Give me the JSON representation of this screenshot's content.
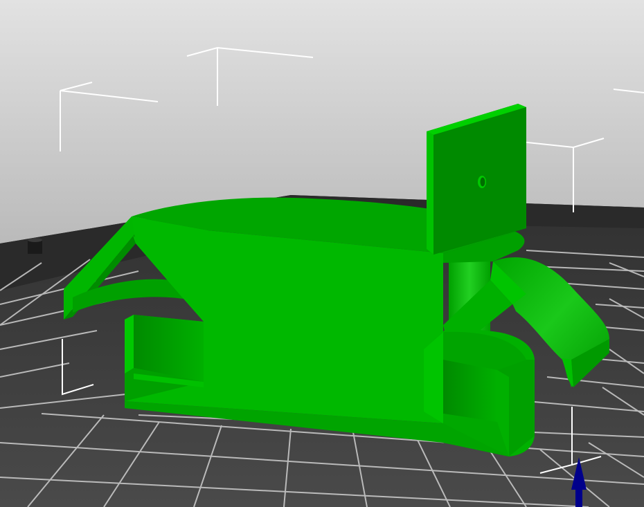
{
  "viewport": {
    "background_top": "#e0e0e0",
    "background_bottom": "#8e8e8e",
    "bed_color": "#3a3a3a",
    "grid_color": "#c8c8c8",
    "border_color": "#222222"
  },
  "model": {
    "color": "#00b800",
    "shade_dark": "#009400",
    "shade_darker": "#007a00",
    "shade_light": "#22d022",
    "selected": true
  },
  "bounding_box": {
    "color": "#ffffff"
  },
  "axis_arrow": {
    "axis": "z",
    "color": "#00008b"
  },
  "bed_icon": {
    "name": "bed-object-icon"
  }
}
